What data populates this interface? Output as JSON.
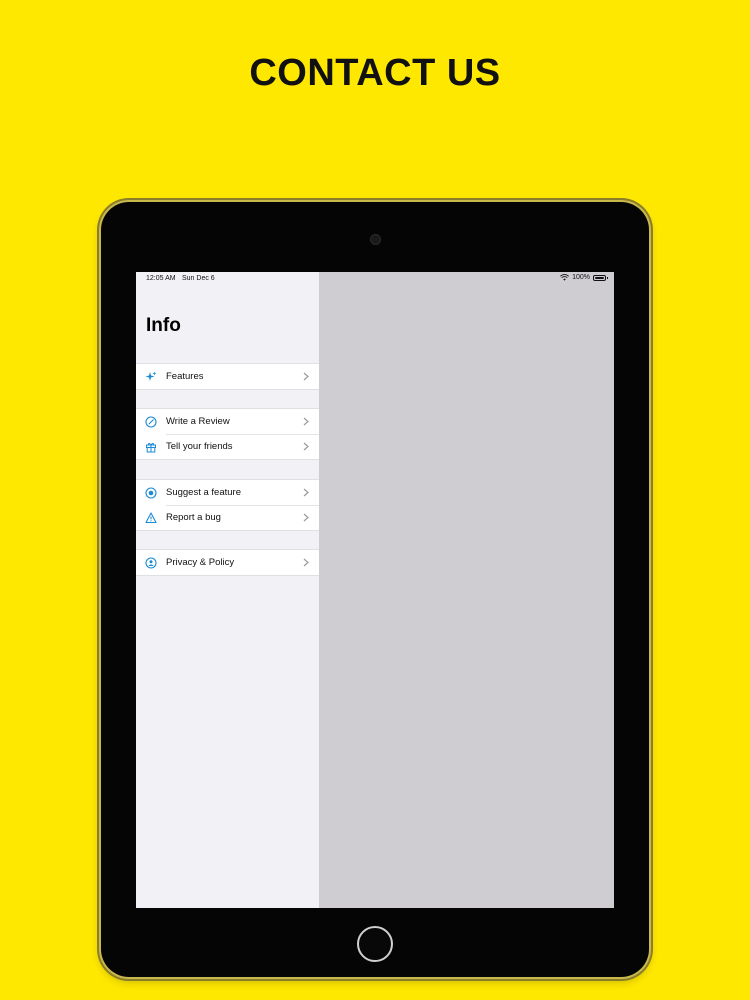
{
  "promo": {
    "headline": "CONTACT US"
  },
  "status_bar": {
    "time": "12:05 AM",
    "date": "Sun Dec 6",
    "battery": "100%"
  },
  "sidebar": {
    "title": "Info",
    "groups": [
      {
        "items": [
          {
            "label": "Features",
            "icon": "sparkles-icon"
          }
        ]
      },
      {
        "items": [
          {
            "label": "Write a Review",
            "icon": "pencil-circle-icon"
          },
          {
            "label": "Tell your friends",
            "icon": "gift-icon"
          }
        ]
      },
      {
        "items": [
          {
            "label": "Suggest a feature",
            "icon": "target-icon"
          },
          {
            "label": "Report a bug",
            "icon": "warning-triangle-icon"
          }
        ]
      },
      {
        "items": [
          {
            "label": "Privacy & Policy",
            "icon": "person-shield-icon"
          }
        ]
      }
    ]
  },
  "colors": {
    "background": "#FFE800",
    "accent": "#1A8BD6",
    "detail_pane": "#CFCDD2",
    "sidebar_bg": "#F2F2F6"
  }
}
